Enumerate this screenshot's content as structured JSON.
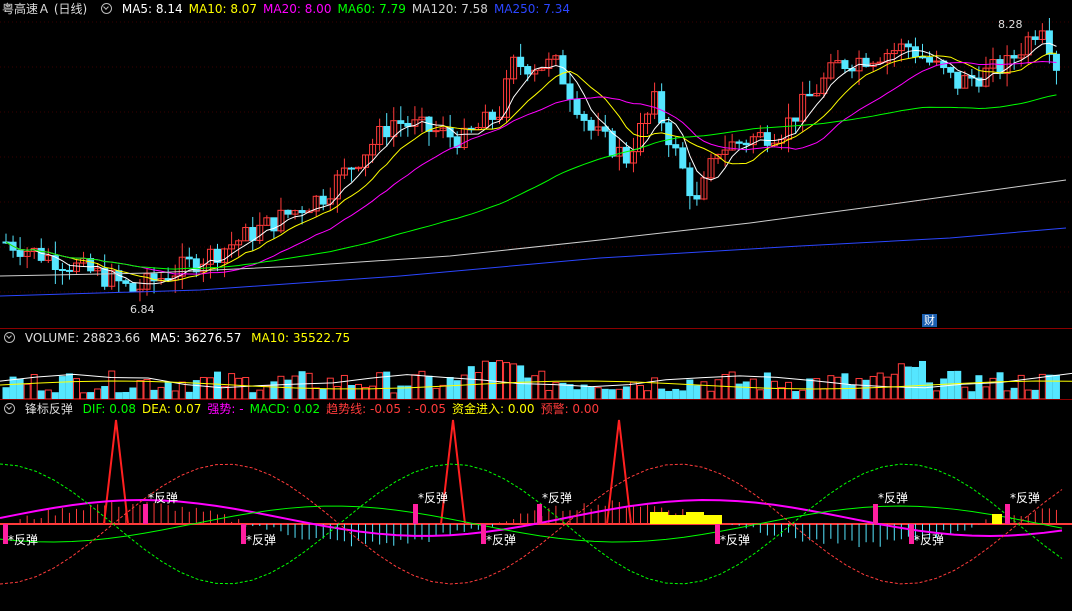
{
  "price": {
    "title": "粤高速Ａ (日线)",
    "ma": [
      {
        "label": "MA5: 8.14",
        "color": "#ffffff"
      },
      {
        "label": "MA10: 8.07",
        "color": "#ffff00"
      },
      {
        "label": "MA20: 8.00",
        "color": "#ff00ff"
      },
      {
        "label": "MA60: 7.79",
        "color": "#00ff00"
      },
      {
        "label": "MA120: 7.58",
        "color": "#d0d0d0"
      },
      {
        "label": "MA250: 7.34",
        "color": "#2b46ff"
      }
    ],
    "high_label": "8.28",
    "low_label": "6.84",
    "badge": "财"
  },
  "volume": {
    "title": "VOLUME: 28823.66",
    "ma5": "MA5: 36276.57",
    "ma10": "MA10: 35522.75",
    "colors": {
      "up": "#ff3b3b",
      "down": "#55e6ff",
      "ma5": "#ffffff",
      "ma10": "#ffff00"
    }
  },
  "indicator": {
    "title": "锋标反弹",
    "fields": [
      {
        "label": "DIF: 0.08",
        "color": "#00ff00"
      },
      {
        "label": "DEA: 0.07",
        "color": "#ffff00"
      },
      {
        "label": "强势: -",
        "color": "#ff00ff"
      },
      {
        "label": "MACD: 0.02",
        "color": "#00ff00"
      },
      {
        "label": "趋势线: -0.05",
        "color": "#ff3b3b"
      },
      {
        "label": ": -0.05",
        "color": "#ff3b3b"
      },
      {
        "label": "资金进入: 0.00",
        "color": "#ffff00"
      },
      {
        "label": "预警: 0.00",
        "color": "#ff3b3b"
      }
    ],
    "signal_text": "反弹",
    "signals": [
      6,
      146,
      244,
      416,
      484,
      540,
      718,
      876,
      912,
      1008
    ]
  }
}
